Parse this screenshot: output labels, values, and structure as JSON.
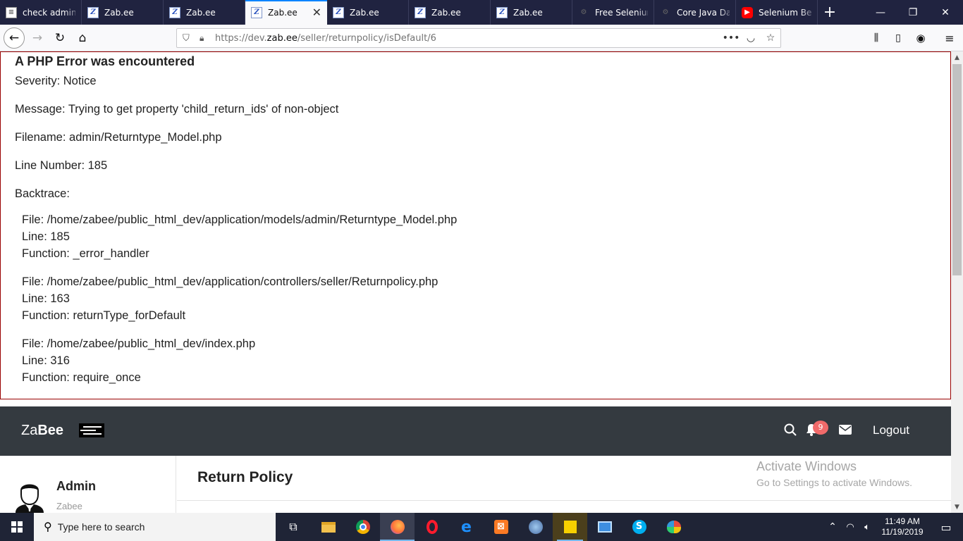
{
  "browser": {
    "tabs": [
      {
        "title": "check admin",
        "favicon": "doc-icon",
        "active": false
      },
      {
        "title": "Zab.ee",
        "favicon": "zabee-icon",
        "active": false
      },
      {
        "title": "Zab.ee",
        "favicon": "zabee-icon",
        "active": false
      },
      {
        "title": "Zab.ee",
        "favicon": "zabee-icon",
        "active": true
      },
      {
        "title": "Zab.ee",
        "favicon": "zabee-icon",
        "active": false
      },
      {
        "title": "Zab.ee",
        "favicon": "zabee-icon",
        "active": false
      },
      {
        "title": "Zab.ee",
        "favicon": "zabee-icon",
        "active": false
      },
      {
        "title": "Free Selenium",
        "favicon": "gear-icon",
        "active": false
      },
      {
        "title": "Core Java Dat",
        "favicon": "gear-icon",
        "active": false
      },
      {
        "title": "Selenium Beg",
        "favicon": "youtube-icon",
        "active": false
      }
    ],
    "url_prefix": "https://dev.",
    "url_domain": "zab.ee",
    "url_path": "/seller/returnpolicy/isDefault/6"
  },
  "error": {
    "heading": "A PHP Error was encountered",
    "severity": "Severity: Notice",
    "message": "Message: Trying to get property 'child_return_ids' of non-object",
    "filename": "Filename: admin/Returntype_Model.php",
    "line_number": "Line Number: 185",
    "backtrace_label": "Backtrace:",
    "backtrace": [
      {
        "file": "File: /home/zabee/public_html_dev/application/models/admin/Returntype_Model.php",
        "line": "Line: 185",
        "function": "Function: _error_handler"
      },
      {
        "file": "File: /home/zabee/public_html_dev/application/controllers/seller/Returnpolicy.php",
        "line": "Line: 163",
        "function": "Function: returnType_forDefault"
      },
      {
        "file": "File: /home/zabee/public_html_dev/index.php",
        "line": "Line: 316",
        "function": "Function: require_once"
      }
    ]
  },
  "site": {
    "brand_light": "Za",
    "brand_bold": "Bee",
    "notification_count": "9",
    "logout_label": "Logout",
    "user_name": "Admin",
    "user_sub": "Zabee",
    "page_title": "Return Policy"
  },
  "watermark": {
    "line1": "Activate Windows",
    "line2": "Go to Settings to activate Windows."
  },
  "taskbar": {
    "search_placeholder": "Type here to search",
    "time": "11:49 AM",
    "date": "11/19/2019"
  },
  "colors": {
    "header_bg": "#343a40",
    "error_border": "#990000",
    "badge": "#f16a6a",
    "tab_accent": "#0a84ff"
  }
}
